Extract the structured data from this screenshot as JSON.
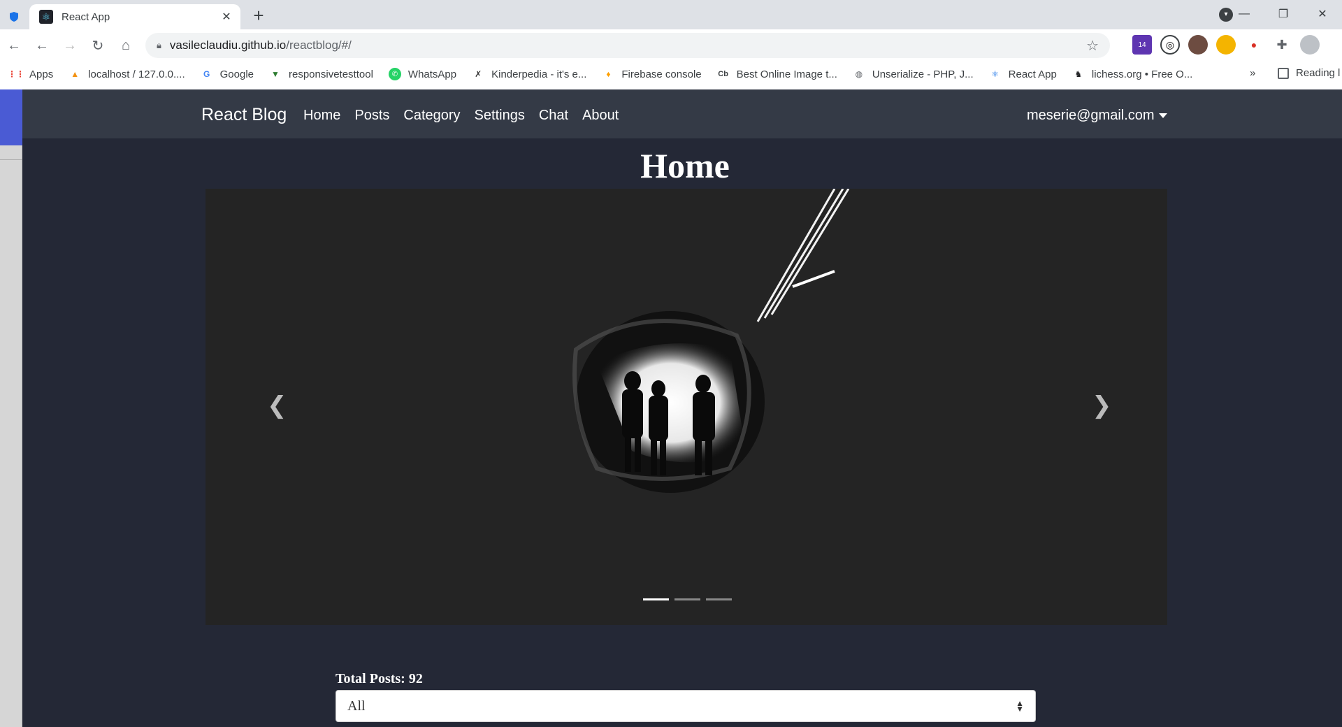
{
  "browser": {
    "tab_title": "React App",
    "url_host": "vasileclaudiu.github.io",
    "url_path": "/reactblog/#/",
    "extension_badge": "14",
    "bookmarks": [
      {
        "label": "Apps",
        "icon": "apps-grid-icon",
        "color": "#ea4335"
      },
      {
        "label": "localhost / 127.0.0....",
        "icon": "phpmyadmin-icon",
        "color": "#f29111"
      },
      {
        "label": "Google",
        "icon": "google-icon",
        "color": "#4285f4"
      },
      {
        "label": "responsivetesttool",
        "icon": "vue-icon",
        "color": "#2e7d32"
      },
      {
        "label": "WhatsApp",
        "icon": "whatsapp-icon",
        "color": "#25d366"
      },
      {
        "label": "Kinderpedia - it's e...",
        "icon": "kinderpedia-icon",
        "color": "#333333"
      },
      {
        "label": "Firebase console",
        "icon": "firebase-icon",
        "color": "#ffa000"
      },
      {
        "label": "Best Online Image t...",
        "icon": "cb-icon",
        "color": "#202124"
      },
      {
        "label": "Unserialize - PHP, J...",
        "icon": "globe-icon",
        "color": "#5f6368"
      },
      {
        "label": "React App",
        "icon": "react-icon",
        "color": "#1a73e8"
      },
      {
        "label": "lichess.org • Free O...",
        "icon": "lichess-icon",
        "color": "#202124"
      }
    ],
    "bookmarks_overflow": "»",
    "reading_list": "Reading l"
  },
  "app": {
    "brand": "React Blog",
    "nav": [
      "Home",
      "Posts",
      "Category",
      "Settings",
      "Chat",
      "About"
    ],
    "user_email": "meserie@gmail.com",
    "page_title": "Home",
    "carousel": {
      "slide_count": 3,
      "active_slide": 1
    },
    "total_posts": "Total Posts: 92",
    "category_filter": "All"
  },
  "colors": {
    "navbar": "#343a46",
    "page_bg": "#242836",
    "carousel_bg": "#242424",
    "side_accent": "#4a5bd4"
  }
}
